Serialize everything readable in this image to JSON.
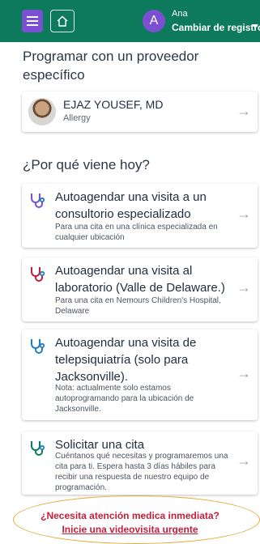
{
  "header": {
    "avatar_initial": "A",
    "user_name": "Ana",
    "switch_label": "Cambiar de registro"
  },
  "provider_section": {
    "title": "Programar con un proveedor específico",
    "provider": {
      "name": "EJAZ YOUSEF, MD",
      "specialty": "Allergy"
    }
  },
  "visit_section": {
    "title": "¿Por qué viene hoy?",
    "options": [
      {
        "title": "Autoagendar una visita a un consultorio especializado",
        "description": "Para una cita en una clínica especializada en cualquier ubicación",
        "icon_color": "#7b4fd1"
      },
      {
        "title": "Autoagendar una visita al laboratorio (Valle de Delaware.)",
        "description": "Para una cita en Nemours Children's Hospital, Delaware",
        "icon_color": "#c51f3a"
      },
      {
        "title": "Autoagendar una visita de telepsiquiatría (solo para Jacksonville).",
        "description": "Nota: actualmente solo estamos autoprogramando para la ubicación de Jacksonville.",
        "icon_color": "#1f7fc4"
      },
      {
        "title": "Solicitar una cita",
        "description": "Cuéntanos qué necesitas y programaremos una cita para ti. Espera hasta 3 días hábiles para recibir una respuesta de nuestro equipo de programación.",
        "icon_color": "#0e7a5c"
      }
    ]
  },
  "urgent": {
    "question": "¿Necesita atención medica inmediata?",
    "link": "Inicie una videovisita urgente"
  },
  "colors": {
    "header": "#0e7a5c",
    "accent": "#7b4fd1",
    "urgent_text": "#c51f3a",
    "highlight_ring": "#e7a83a"
  },
  "icons": [
    "menu-icon",
    "home-icon",
    "chevron-down-icon",
    "arrow-right-icon",
    "stethoscope-icon"
  ]
}
